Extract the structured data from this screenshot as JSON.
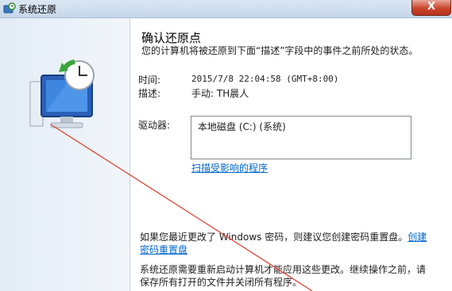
{
  "window": {
    "title": "系统还原",
    "close_label": "X"
  },
  "confirm": {
    "heading": "确认还原点",
    "description": "您的计算机将被还原到下面“描述”字段中的事件之前所处的状态。",
    "time_label": "时间:",
    "time_value": "2015/7/8 22:04:58 (GMT+8:00)",
    "desc_label": "描述:",
    "desc_value": "手动: TH晨人",
    "drives_label": "驱动器:",
    "drives": [
      "本地磁盘 (C:) (系统)"
    ],
    "scan_link": "扫描受影响的程序",
    "password_note": "如果您最近更改了 Windows 密码，则建议您创建密码重置盘。",
    "password_link": "创建密码重置盘",
    "restart_note": "系统还原需要重新启动计算机才能应用这些更改。继续操作之前，请保存所有打开的文件并关闭所有程序。"
  },
  "colors": {
    "link": "#0066cc",
    "annotation_line": "#e03a2a",
    "close_button": "#c9462c"
  }
}
